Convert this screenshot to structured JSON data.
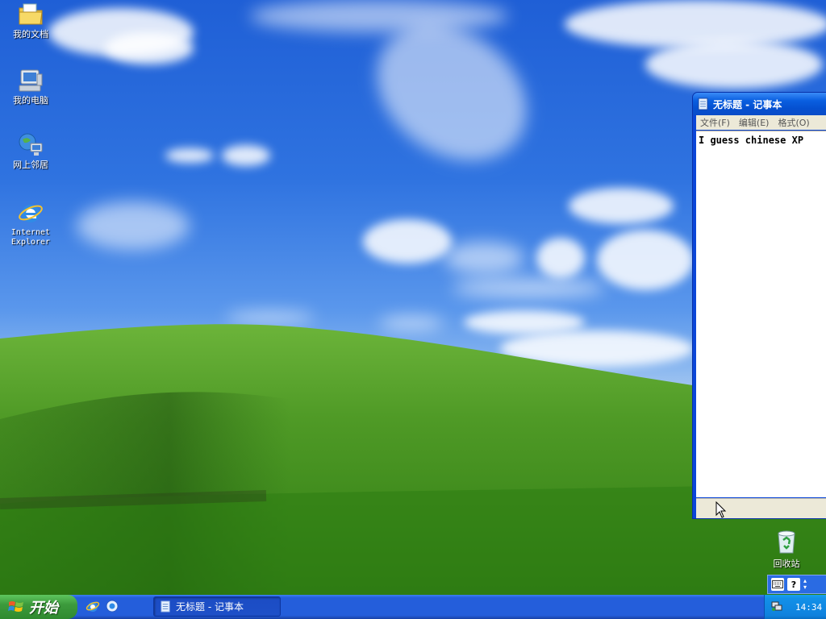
{
  "desktop": {
    "icons": [
      {
        "label": "我的文档",
        "icon": "my-documents-icon"
      },
      {
        "label": "我的电脑",
        "icon": "my-computer-icon"
      },
      {
        "label": "网上邻居",
        "icon": "network-places-icon"
      },
      {
        "label": "Internet\nExplorer",
        "icon": "internet-explorer-icon"
      }
    ],
    "recycle_bin": {
      "label": "回收站",
      "icon": "recycle-bin-icon"
    }
  },
  "notepad": {
    "title": "无标题 - 记事本",
    "menu": [
      "文件(F)",
      "编辑(E)",
      "格式(O)"
    ],
    "content": "I guess chinese XP"
  },
  "taskbar": {
    "start_label": "开始",
    "quick_launch": [
      "internet-explorer-icon",
      "show-desktop-icon"
    ],
    "task_button_label": "无标题 - 记事本",
    "clock": "14:34",
    "language_bar": [
      "keyboard-icon",
      "help-icon"
    ]
  },
  "colors": {
    "taskbar_blue": "#245edb",
    "start_green": "#3c9a3c",
    "tray_blue": "#0f82de",
    "title_blue": "#0a5fe0",
    "menu_gray": "#ece9d8"
  }
}
